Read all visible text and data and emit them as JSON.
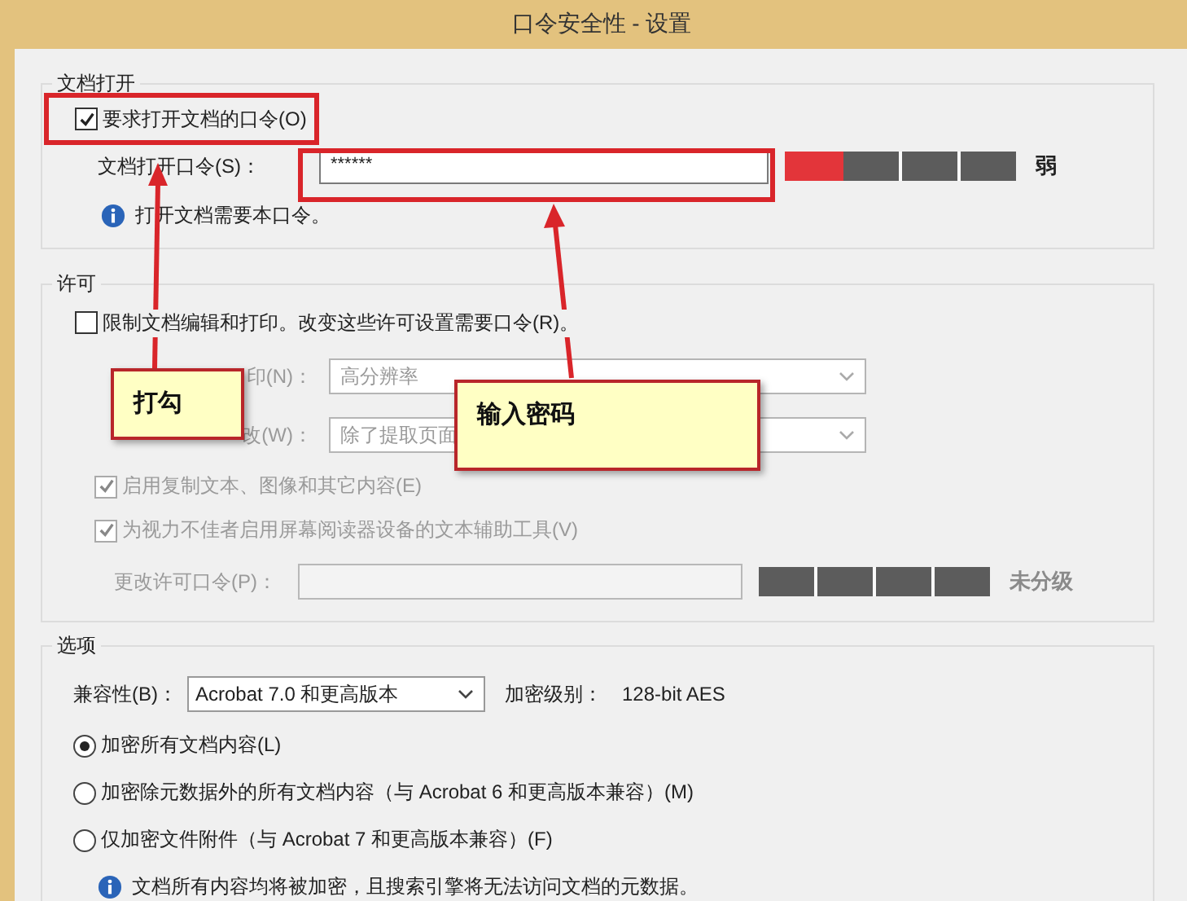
{
  "window": {
    "title": "口令安全性 - 设置"
  },
  "document_open": {
    "legend": "文档打开",
    "require_password": {
      "label": "要求打开文档的口令(O)",
      "checked": true
    },
    "password": {
      "label": "文档打开口令(S)：",
      "value": "******"
    },
    "strength": {
      "level": 0.25,
      "reading": "弱"
    },
    "info": "打开文档需要本口令。"
  },
  "permissions": {
    "legend": "许可",
    "restrict": {
      "label": "限制文档编辑和打印。改变这些许可设置需要口令(R)。",
      "checked": false
    },
    "dropdowns": [
      {
        "label": "印(N)：",
        "value": "高分辨率",
        "disabled": true
      },
      {
        "label": "改(W)：",
        "value": "除了提取页面",
        "disabled": true
      }
    ],
    "checkboxes": [
      {
        "label": "启用复制文本、图像和其它内容(E)",
        "checked": true,
        "disabled": true
      },
      {
        "label": "为视力不佳者启用屏幕阅读器设备的文本辅助工具(V)",
        "checked": true,
        "disabled": true
      }
    ],
    "password": {
      "label": "更改许可口令(P)：",
      "disabled": true
    },
    "strength": {
      "reading": "未分级"
    }
  },
  "options": {
    "legend": "选项",
    "compatibility": {
      "label": "兼容性(B)：",
      "value": "Acrobat 7.0 和更高版本"
    },
    "encryption": {
      "label": "加密级别：",
      "value": "128-bit AES"
    },
    "radios": [
      {
        "label": "加密所有文档内容(L)",
        "selected": true
      },
      {
        "label": "加密除元数据外的所有文档内容（与 Acrobat 6 和更高版本兼容）(M)",
        "selected": false
      },
      {
        "label": "仅加密文件附件（与 Acrobat 7 和更高版本兼容）(F)",
        "selected": false
      }
    ],
    "info": "文档所有内容均将被加密，且搜索引擎将无法访问文档的元数据。"
  },
  "annotations": [
    {
      "text": "打勾"
    },
    {
      "text": "输入密码"
    }
  ]
}
